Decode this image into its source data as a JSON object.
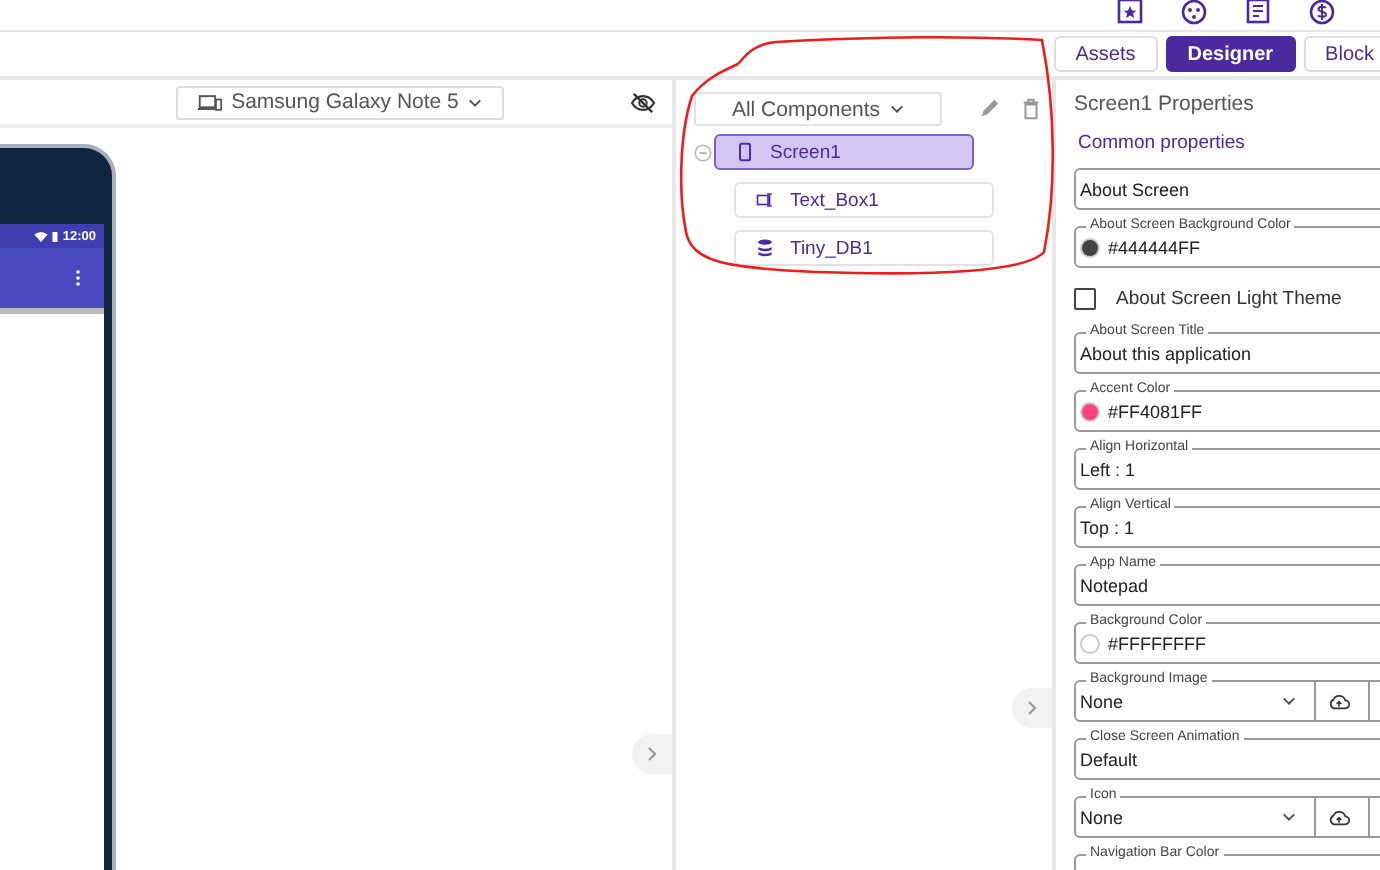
{
  "tabs": [
    {
      "label": "Assets",
      "selected": false
    },
    {
      "label": "Designer",
      "selected": true
    },
    {
      "label": "Block",
      "selected": false
    }
  ],
  "viewer": {
    "device": "Samsung Galaxy Note 5",
    "phone": {
      "time": "12:00"
    }
  },
  "components": {
    "filter": "All Components",
    "tree": [
      {
        "name": "Screen1",
        "kind": "screen",
        "selected": true,
        "expanded": true,
        "children": [
          {
            "name": "Text_Box1",
            "kind": "textbox",
            "selected": false
          },
          {
            "name": "Tiny_DB1",
            "kind": "database",
            "selected": false
          }
        ]
      }
    ]
  },
  "properties": {
    "title": "Screen1 Properties",
    "section": "Common properties",
    "fields": [
      {
        "kind": "text",
        "value": "About Screen"
      },
      {
        "kind": "color",
        "label": "About Screen Background Color",
        "value": "#444444FF",
        "color": "#444444"
      },
      {
        "kind": "checkbox",
        "label": "About Screen Light Theme",
        "checked": false
      },
      {
        "kind": "text",
        "label": "About Screen Title",
        "value": "About this application"
      },
      {
        "kind": "color",
        "label": "Accent Color",
        "value": "#FF4081FF",
        "color": "#ff4081"
      },
      {
        "kind": "select",
        "label": "Align Horizontal",
        "value": "Left : 1"
      },
      {
        "kind": "select",
        "label": "Align Vertical",
        "value": "Top : 1"
      },
      {
        "kind": "text",
        "label": "App Name",
        "value": "Notepad"
      },
      {
        "kind": "color",
        "label": "Background Color",
        "value": "#FFFFFFFF",
        "color": "#ffffff"
      },
      {
        "kind": "asset",
        "label": "Background Image",
        "value": "None"
      },
      {
        "kind": "select",
        "label": "Close Screen Animation",
        "value": "Default"
      },
      {
        "kind": "asset",
        "label": "Icon",
        "value": "None"
      },
      {
        "kind": "color",
        "label": "Navigation Bar Color"
      }
    ]
  }
}
